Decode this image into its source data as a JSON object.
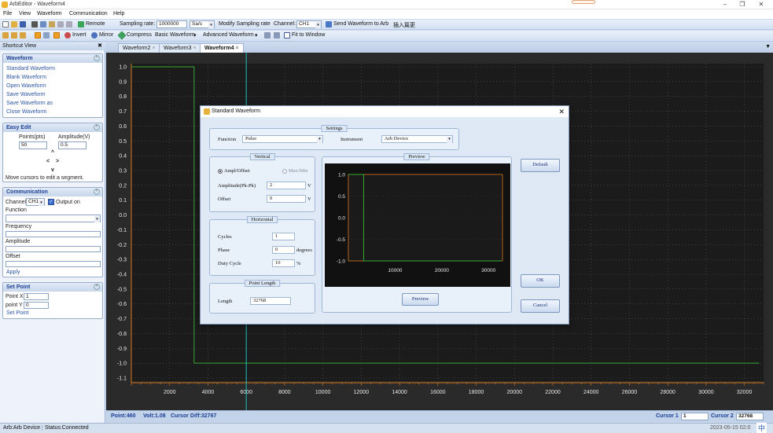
{
  "titlebar": {
    "app": "ArbEditor",
    "doc": "Waveform4",
    "title": "ArbEditor - Waveform4"
  },
  "menu": [
    "File",
    "View",
    "Waveform",
    "Communication",
    "Help"
  ],
  "toolbar1": {
    "remote": "Remote",
    "sampling_label": "Sampling rate:",
    "sampling_value": "1000000",
    "sampling_unit": "Sa/s",
    "modify": "Modify Sampling rate",
    "channel_label": "Channel:",
    "channel_value": "CH1",
    "send": "Send Waveform to Arb",
    "ime": "插入篇更"
  },
  "toolbar2": {
    "invert": "Invert",
    "mirror": "Mirror",
    "compress": "Compress",
    "basic": "Basic Waveform",
    "advanced": "Advanced Waveform",
    "fit": "Fit to Window"
  },
  "sidebar": {
    "header": "Shortcut View",
    "waveform": {
      "title": "Waveform",
      "items": [
        "Standard Waveform",
        "Blank Waveform",
        "Open Waveform",
        "Save Waveform",
        "Save Waveform as",
        "Close Waveform"
      ]
    },
    "easy_edit": {
      "title": "Easy Edit",
      "points_label": "Points(pts)",
      "amplitude_label": "Amplitude(V)",
      "points_value": "50",
      "amplitude_value": "0.5",
      "up": "^",
      "left": "<",
      "right": ">",
      "down": "v",
      "hint": "Move cursors to edit a segment."
    },
    "communication": {
      "title": "Communication",
      "channel_label": "Channel",
      "channel_value": "CH1",
      "output": "Output on",
      "function_label": "Function",
      "frequency_label": "Frequency",
      "amplitude_label": "Amplitude",
      "offset_label": "Offset",
      "apply": "Apply"
    },
    "set_point": {
      "title": "Set Point",
      "x_label": "Point X",
      "x_value": "1",
      "y_label": "point Y",
      "y_value": "0",
      "button": "Set Point"
    }
  },
  "tabs": [
    "Waveform2",
    "Waveform3",
    "Waveform4"
  ],
  "chart_data": {
    "type": "line",
    "ylim": [
      -1.1,
      1.0
    ],
    "xlim": [
      0,
      33000
    ],
    "yticks": [
      "1.0",
      "0.9",
      "0.8",
      "0.7",
      "0.6",
      "0.5",
      "0.4",
      "0.3",
      "0.2",
      "0.1",
      "0.0",
      "-0.1",
      "-0.2",
      "-0.3",
      "-0.4",
      "-0.5",
      "-0.6",
      "-0.7",
      "-0.8",
      "-0.9",
      "-1.0",
      "-1.1"
    ],
    "xticks": [
      "2000",
      "4000",
      "6000",
      "8000",
      "10000",
      "12000",
      "14000",
      "16000",
      "18000",
      "20000",
      "22000",
      "24000",
      "26000",
      "28000",
      "30000",
      "32000"
    ],
    "series": [
      {
        "x": [
          0,
          3277,
          3277,
          32767
        ],
        "y": [
          1.0,
          1.0,
          -1.0,
          -1.0
        ],
        "color": "#33aa33"
      }
    ],
    "cursor": {
      "x": 6000,
      "color": "#1cbfc0"
    }
  },
  "plot_status": {
    "point": "Point:460",
    "volt": "Volt:1.08",
    "diff": "Cursor Diff:32767",
    "cursor1_label": "Cursor 1",
    "cursor1_value": "1",
    "cursor2_label": "Cursor 2",
    "cursor2_value": "32768"
  },
  "statusbar": {
    "device": "Arb:Arb Device",
    "status": "Status:Connected",
    "time": "2023-05-15 02:0",
    "ime": "中"
  },
  "dialog": {
    "title": "Standard Waveform",
    "settings_title": "Settings",
    "function_label": "Function",
    "function_value": "Pulse",
    "instrument_label": "Instrument",
    "instrument_value": "Arb Device",
    "vertical_title": "Vertical",
    "ampl_offset": "Ampl/Offset",
    "max_min": "Max/Min",
    "amplitude_label": "Amplitude(Pk-Pk)",
    "amplitude_value": "2",
    "amplitude_unit": "V",
    "offset_label": "Offset",
    "offset_value": "0",
    "offset_unit": "V",
    "horizontal_title": "Horizontal",
    "cycles_label": "Cycles",
    "cycles_value": "1",
    "phase_label": "Phase",
    "phase_value": "0",
    "phase_unit": "degrees",
    "duty_label": "Duty Cycle",
    "duty_value": "10",
    "duty_unit": "%",
    "length_title": "Point Length",
    "length_label": "Length",
    "length_value": "32768",
    "preview_title": "Preview",
    "preview_button": "Preview",
    "default_button": "Default",
    "ok_button": "OK",
    "cancel_button": "Cancel",
    "preview_chart": {
      "yticks": [
        "1.0",
        "0.5",
        "0.0",
        "-0.5",
        "-1.0"
      ],
      "xticks": [
        "10000",
        "20000",
        "30000"
      ],
      "x": [
        0,
        3277,
        3277,
        32767
      ],
      "y": [
        1.0,
        1.0,
        -1.0,
        -1.0
      ],
      "ylim": [
        -1.0,
        1.0
      ],
      "xlim": [
        0,
        33000
      ]
    }
  }
}
